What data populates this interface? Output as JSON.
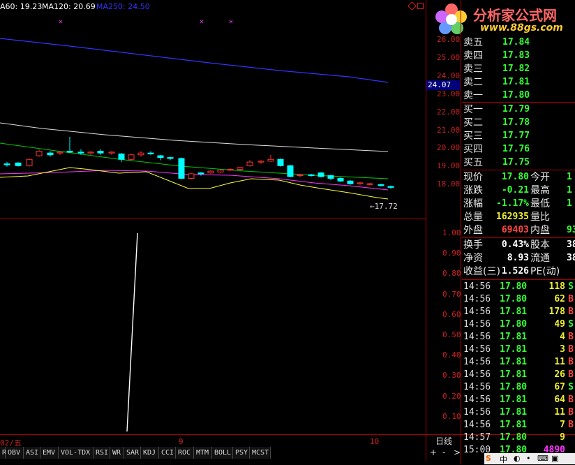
{
  "ma_header": {
    "ma60": "A60: 19.23",
    "ma120": "MA120: 20.69",
    "ma250": "MA250: 24.50"
  },
  "logo": {
    "title": "分析家公式网",
    "url": "www.88gs.com"
  },
  "price_axis": [
    "26.00",
    "25.00",
    "24.00",
    "23.00",
    "22.00",
    "21.00",
    "20.00",
    "19.00",
    "18.00"
  ],
  "price_marker": "24.07",
  "low_label": "←17.72",
  "indicator_axis": [
    "1.00",
    "0.90",
    "0.80",
    "0.70",
    "0.60",
    "0.50",
    "0.40",
    "0.30",
    "0.20",
    "0.10"
  ],
  "date_axis": {
    "left": "02/五",
    "mid": "9",
    "right": "10"
  },
  "period_label": "日线",
  "indicator_tabs": [
    "OBV",
    "ASI",
    "EMV",
    "VOL-TDX",
    "RSI",
    "WR",
    "SAR",
    "KDJ",
    "CCI",
    "ROC",
    "MTM",
    "BOLL",
    "PSY",
    "MCST"
  ],
  "orderbook": {
    "asks": [
      {
        "label": "卖五",
        "price": "17.84"
      },
      {
        "label": "卖四",
        "price": "17.83"
      },
      {
        "label": "卖三",
        "price": "17.82"
      },
      {
        "label": "卖二",
        "price": "17.81"
      },
      {
        "label": "卖一",
        "price": "17.80"
      }
    ],
    "bids": [
      {
        "label": "买一",
        "price": "17.79"
      },
      {
        "label": "买二",
        "price": "17.78"
      },
      {
        "label": "买三",
        "price": "17.77"
      },
      {
        "label": "买四",
        "price": "17.76"
      },
      {
        "label": "买五",
        "price": "17.75"
      }
    ]
  },
  "quote": {
    "rows": [
      {
        "l1": "现价",
        "v1": "17.80",
        "l2": "今开",
        "v2": "1"
      },
      {
        "l1": "涨跌",
        "v1": "-0.21",
        "l2": "最高",
        "v2": "1"
      },
      {
        "l1": "涨幅",
        "v1": "-1.17%",
        "l2": "最低",
        "v2": "1"
      },
      {
        "l1": "总量",
        "v1": "162935",
        "l2": "量比",
        "v2": ""
      },
      {
        "l1": "外盘",
        "v1": "69403",
        "l2": "内盘",
        "v2": "93"
      }
    ],
    "fin": [
      {
        "l1": "换手",
        "v1": "0.43%",
        "l2": "股本",
        "v2": "38"
      },
      {
        "l1": "净资",
        "v1": "8.93",
        "l2": "流通",
        "v2": "38"
      },
      {
        "l1": "收益(三)",
        "v1": "1.526",
        "l2": "PE(动)",
        "v2": ""
      }
    ]
  },
  "ticks": [
    {
      "time": "14:56",
      "price": "17.80",
      "vol": "118",
      "side": "S"
    },
    {
      "time": "14:56",
      "price": "17.80",
      "vol": "62",
      "side": "B"
    },
    {
      "time": "14:56",
      "price": "17.81",
      "vol": "178",
      "side": "B"
    },
    {
      "time": "14:56",
      "price": "17.80",
      "vol": "49",
      "side": "S"
    },
    {
      "time": "14:56",
      "price": "17.81",
      "vol": "4",
      "side": "B"
    },
    {
      "time": "14:56",
      "price": "17.81",
      "vol": "3",
      "side": "B"
    },
    {
      "time": "14:56",
      "price": "17.81",
      "vol": "11",
      "side": "B"
    },
    {
      "time": "14:56",
      "price": "17.81",
      "vol": "26",
      "side": "B"
    },
    {
      "time": "14:56",
      "price": "17.80",
      "vol": "67",
      "side": "S"
    },
    {
      "time": "14:56",
      "price": "17.81",
      "vol": "64",
      "side": "B"
    },
    {
      "time": "14:56",
      "price": "17.81",
      "vol": "11",
      "side": "B"
    },
    {
      "time": "14:56",
      "price": "17.81",
      "vol": "7",
      "side": "B"
    },
    {
      "time": "14:57",
      "price": "17.80",
      "vol": "9",
      "side": ""
    },
    {
      "time": "15:00",
      "price": "17.80",
      "vol": "4890",
      "side": ""
    }
  ],
  "colors": {
    "up": "#ff3333",
    "down": "#00ffff",
    "ma_blue": "#3333ff",
    "ma_white": "#dddddd",
    "ma_green": "#00cc00",
    "ma_magenta": "#ff33ff",
    "ma_yellow": "#ffff33",
    "frame": "#aa0000"
  }
}
